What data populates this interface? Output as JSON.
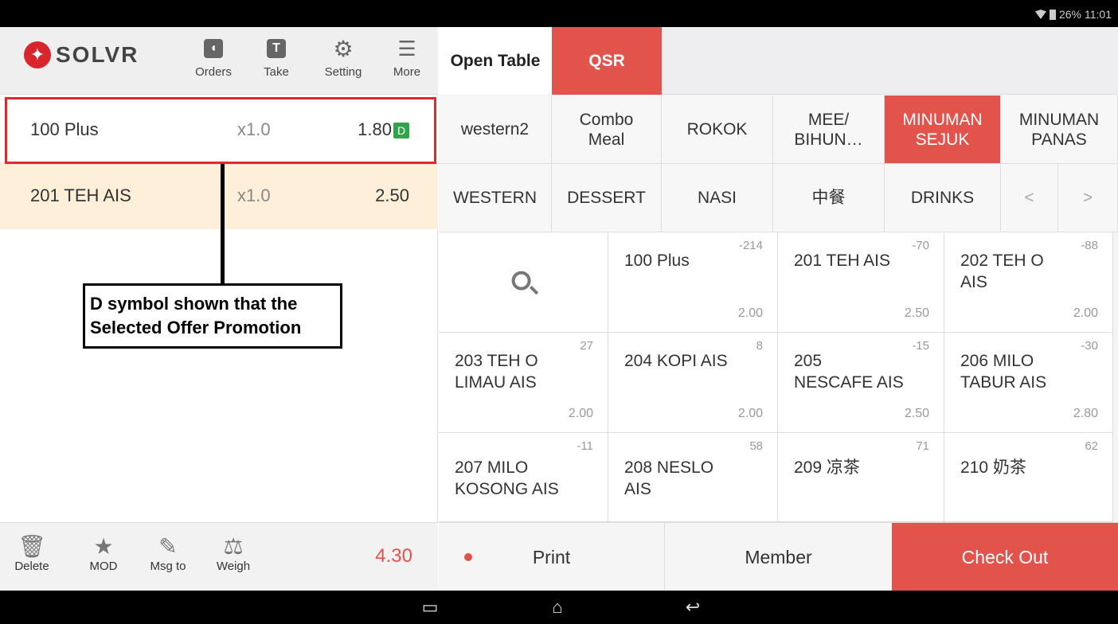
{
  "status_bar": {
    "battery": "26%",
    "time": "11:01"
  },
  "header": {
    "logo_text": "SOLVR",
    "tools": [
      {
        "label": "Orders",
        "icon": "speaker-icon"
      },
      {
        "label": "Take",
        "icon": "t-icon"
      },
      {
        "label": "Setting",
        "icon": "gear-icon"
      },
      {
        "label": "More",
        "icon": "list-icon"
      }
    ]
  },
  "order": {
    "items": [
      {
        "name": "100 Plus",
        "qty": "x1.0",
        "price": "1.80",
        "badge": "D"
      },
      {
        "name": "201 TEH AIS",
        "qty": "x1.0",
        "price": "2.50"
      }
    ],
    "callout": "D symbol shown that the Selected Offer Promotion",
    "total": "4.30"
  },
  "bottom_tools": [
    {
      "label": "Delete",
      "icon": "trash-icon"
    },
    {
      "label": "MOD",
      "icon": "star-icon"
    },
    {
      "label": "Msg to",
      "icon": "pencil-icon"
    },
    {
      "label": "Weigh",
      "icon": "scale-icon"
    }
  ],
  "tabs": {
    "open_table": "Open Table",
    "qsr": "QSR"
  },
  "categories_row1": [
    "western2",
    "Combo\nMeal",
    "ROKOK",
    "MEE/\nBIHUN…",
    "MINUMAN\nSEJUK",
    "MINUMAN\nPANAS"
  ],
  "categories_row2": [
    "WESTERN",
    "DESSERT",
    "NASI",
    "中餐",
    "DRINKS",
    "<",
    ">"
  ],
  "products": [
    {
      "name": "100 Plus",
      "stock": "-214",
      "price": "2.00"
    },
    {
      "name": "201 TEH AIS",
      "stock": "-70",
      "price": "2.50"
    },
    {
      "name": "202 TEH O\nAIS",
      "stock": "-88",
      "price": "2.00"
    },
    {
      "name": "203 TEH O\nLIMAU AIS",
      "stock": "27",
      "price": "2.00"
    },
    {
      "name": "204 KOPI AIS",
      "stock": "8",
      "price": "2.00"
    },
    {
      "name": "205\nNESCAFE AIS",
      "stock": "-15",
      "price": "2.50"
    },
    {
      "name": "206 MILO\nTABUR AIS",
      "stock": "-30",
      "price": "2.80"
    },
    {
      "name": "207 MILO\nKOSONG AIS",
      "stock": "-11",
      "price": ""
    },
    {
      "name": "208 NESLO\nAIS",
      "stock": "58",
      "price": ""
    },
    {
      "name": "209 凉茶",
      "stock": "71",
      "price": ""
    },
    {
      "name": "210 奶茶",
      "stock": "62",
      "price": ""
    }
  ],
  "actions": {
    "print": "Print",
    "member": "Member",
    "checkout": "Check Out"
  }
}
